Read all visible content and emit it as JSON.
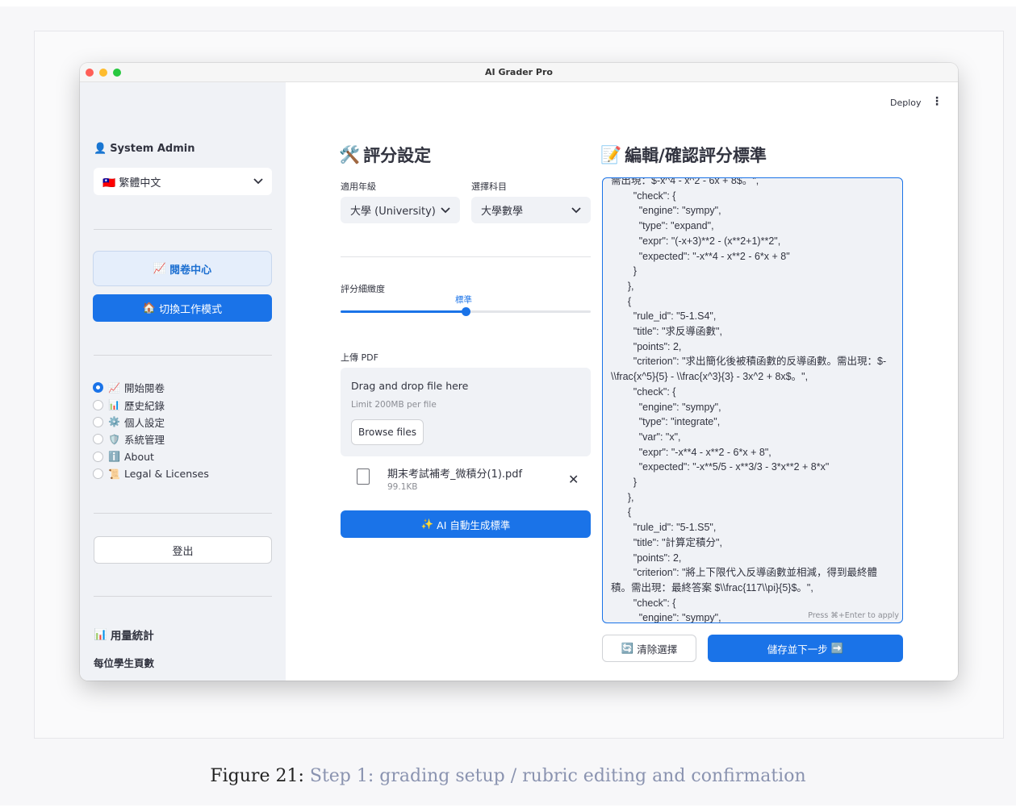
{
  "window": {
    "title": "AI Grader Pro"
  },
  "header": {
    "deploy_label": "Deploy",
    "menu_icon": "⋮"
  },
  "sidebar": {
    "user_icon": "👤",
    "user_name": "System Admin",
    "language": {
      "flag": "🇹🇼",
      "value": "繁體中文"
    },
    "reading_center": {
      "icon": "📈",
      "label": "閱卷中心"
    },
    "switch_mode": {
      "icon": "🏠",
      "label": "切換工作模式"
    },
    "nav": [
      {
        "icon": "📈",
        "label": "開始閱卷",
        "selected": true
      },
      {
        "icon": "📊",
        "label": "歷史紀錄",
        "selected": false
      },
      {
        "icon": "⚙️",
        "label": "個人設定",
        "selected": false
      },
      {
        "icon": "🛡️",
        "label": "系統管理",
        "selected": false
      },
      {
        "icon": "ℹ️",
        "label": "About",
        "selected": false
      },
      {
        "icon": "📜",
        "label": "Legal & Licenses",
        "selected": false
      }
    ],
    "logout_label": "登出",
    "usage": {
      "icon": "📊",
      "title": "用量統計",
      "subtitle": "每位學生頁數"
    }
  },
  "settings": {
    "icon": "🛠️",
    "title": "評分設定",
    "grade": {
      "label": "適用年級",
      "value": "大學 (University)"
    },
    "subject": {
      "label": "選擇科目",
      "value": "大學數學"
    },
    "granularity": {
      "label": "評分細緻度",
      "value": "標準",
      "position_fraction": 0.5
    },
    "upload": {
      "label": "上傳 PDF",
      "drop_title": "Drag and drop file here",
      "drop_limit": "Limit 200MB per file",
      "browse_label": "Browse files",
      "file_name": "期末考試補考_微積分(1).pdf",
      "file_size": "99.1KB"
    },
    "generate": {
      "icon": "✨",
      "label": "AI 自動生成標準"
    }
  },
  "rubric": {
    "icon": "📝",
    "title": "編輯/確認評分標準",
    "content": "需出現：$-x^4 - x^2 - 6x + 8$。\",\n        \"check\": {\n          \"engine\": \"sympy\",\n          \"type\": \"expand\",\n          \"expr\": \"(-x+3)**2 - (x**2+1)**2\",\n          \"expected\": \"-x**4 - x**2 - 6*x + 8\"\n        }\n      },\n      {\n        \"rule_id\": \"5-1.S4\",\n        \"title\": \"求反導函數\",\n        \"points\": 2,\n        \"criterion\": \"求出簡化後被積函數的反導函數。需出現：$-\\\\frac{x^5}{5} - \\\\frac{x^3}{3} - 3x^2 + 8x$。\",\n        \"check\": {\n          \"engine\": \"sympy\",\n          \"type\": \"integrate\",\n          \"var\": \"x\",\n          \"expr\": \"-x**4 - x**2 - 6*x + 8\",\n          \"expected\": \"-x**5/5 - x**3/3 - 3*x**2 + 8*x\"\n        }\n      },\n      {\n        \"rule_id\": \"5-1.S5\",\n        \"title\": \"計算定積分\",\n        \"points\": 2,\n        \"criterion\": \"將上下限代入反導函數並相減，得到最終體積。需出現：最終答案 $\\\\frac{117\\\\pi}{5}$。\",\n        \"check\": {\n          \"engine\": \"sympy\",",
    "hint": "Press ⌘+Enter to apply",
    "clear": {
      "icon": "🔄",
      "label": "清除選擇"
    },
    "save": {
      "label": "儲存並下一步",
      "icon": "➡️"
    }
  },
  "caption": {
    "label": "Figure 21:",
    "text": "Step 1: grading setup / rubric editing and confirmation"
  }
}
